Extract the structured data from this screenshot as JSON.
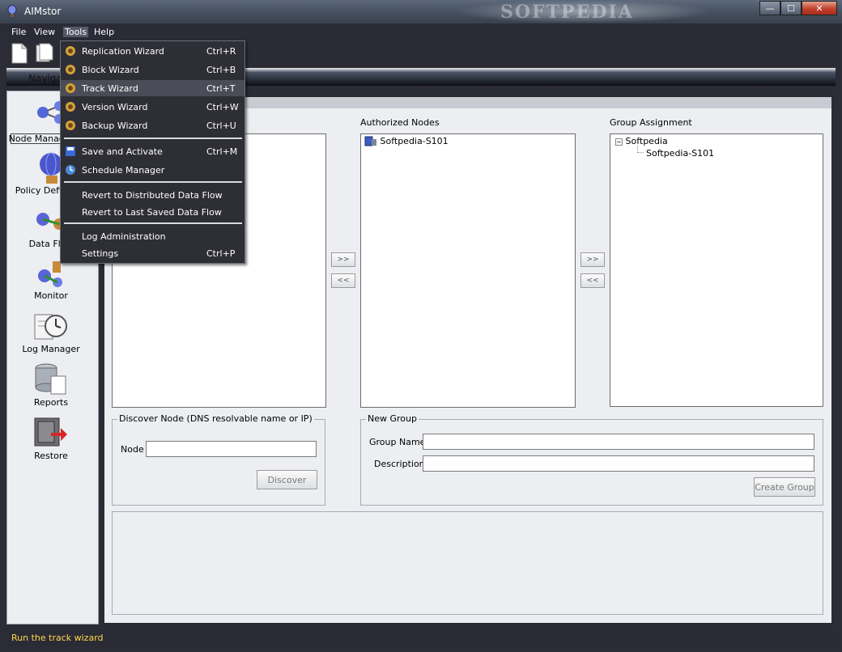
{
  "window": {
    "title": "AIMstor",
    "watermark": "SOFTPEDIA"
  },
  "window_controls": {
    "minimize": "—",
    "maximize": "☐",
    "close": "✕"
  },
  "menubar": {
    "file": "File",
    "view": "View",
    "tools": "Tools",
    "help": "Help"
  },
  "navigation": {
    "header": "Navigation"
  },
  "sidebar": {
    "items": [
      {
        "label": "Node Management"
      },
      {
        "label": "Policy Definition"
      },
      {
        "label": "Data Flow"
      },
      {
        "label": "Monitor"
      },
      {
        "label": "Log Manager"
      },
      {
        "label": "Reports"
      },
      {
        "label": "Restore"
      }
    ]
  },
  "tools_menu": {
    "items": [
      {
        "label": "Replication Wizard",
        "accel": "Ctrl+R"
      },
      {
        "label": "Block Wizard",
        "accel": "Ctrl+B"
      },
      {
        "label": "Track Wizard",
        "accel": "Ctrl+T"
      },
      {
        "label": "Version Wizard",
        "accel": "Ctrl+W"
      },
      {
        "label": "Backup Wizard",
        "accel": "Ctrl+U"
      },
      {
        "label": "Save and Activate",
        "accel": "Ctrl+M"
      },
      {
        "label": "Schedule Manager",
        "accel": ""
      },
      {
        "label": "Revert to Distributed Data Flow",
        "accel": ""
      },
      {
        "label": "Revert to Last Saved Data Flow",
        "accel": ""
      },
      {
        "label": "Log Administration",
        "accel": ""
      },
      {
        "label": "Settings",
        "accel": "Ctrl+P"
      }
    ]
  },
  "nodes": {
    "authorized_label": "Authorized Nodes",
    "authorized": [
      "Softpedia-S101"
    ],
    "group_assignment_label": "Group Assignment",
    "tree_root": "Softpedia",
    "tree_child": "Softpedia-S101",
    "tree_toggle": "−",
    "move_right": ">>",
    "move_left": "<<"
  },
  "discover": {
    "title": "Discover Node (DNS  resolvable name or IP)",
    "node_label": "Node",
    "node_value": "",
    "button": "Discover"
  },
  "new_group": {
    "title": "New Group",
    "name_label": "Group Name",
    "name_value": "",
    "desc_label": "Description",
    "desc_value": "",
    "button": "Create Group"
  },
  "status": {
    "text": "Run the track wizard",
    "color": "#ffd84a"
  }
}
